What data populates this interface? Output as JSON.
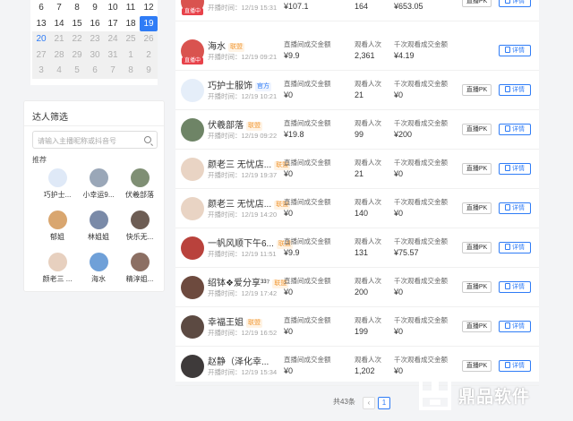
{
  "calendar": {
    "rows": [
      [
        {
          "d": "6",
          "s": ""
        },
        {
          "d": "7",
          "s": ""
        },
        {
          "d": "8",
          "s": ""
        },
        {
          "d": "9",
          "s": ""
        },
        {
          "d": "10",
          "s": ""
        },
        {
          "d": "11",
          "s": ""
        },
        {
          "d": "12",
          "s": ""
        }
      ],
      [
        {
          "d": "13",
          "s": ""
        },
        {
          "d": "14",
          "s": ""
        },
        {
          "d": "15",
          "s": ""
        },
        {
          "d": "16",
          "s": ""
        },
        {
          "d": "17",
          "s": ""
        },
        {
          "d": "18",
          "s": ""
        },
        {
          "d": "19",
          "s": "sel"
        }
      ],
      [
        {
          "d": "20",
          "s": "blue bg"
        },
        {
          "d": "21",
          "s": "gray"
        },
        {
          "d": "22",
          "s": "gray"
        },
        {
          "d": "23",
          "s": "gray"
        },
        {
          "d": "24",
          "s": "gray"
        },
        {
          "d": "25",
          "s": "gray"
        },
        {
          "d": "26",
          "s": "gray"
        }
      ],
      [
        {
          "d": "27",
          "s": "gray"
        },
        {
          "d": "28",
          "s": "gray"
        },
        {
          "d": "29",
          "s": "gray"
        },
        {
          "d": "30",
          "s": "gray"
        },
        {
          "d": "31",
          "s": "gray"
        },
        {
          "d": "1",
          "s": "gray"
        },
        {
          "d": "2",
          "s": "gray"
        }
      ],
      [
        {
          "d": "3",
          "s": "gray"
        },
        {
          "d": "4",
          "s": "gray"
        },
        {
          "d": "5",
          "s": "gray"
        },
        {
          "d": "6",
          "s": "gray"
        },
        {
          "d": "7",
          "s": "gray"
        },
        {
          "d": "8",
          "s": "gray"
        },
        {
          "d": "9",
          "s": "gray"
        }
      ]
    ]
  },
  "filter": {
    "title": "达人筛选",
    "search_placeholder": "请输入主播昵称或抖音号",
    "recommend_label": "推荐",
    "recommended": [
      {
        "name": "巧护士...",
        "color": "#dfe9f7"
      },
      {
        "name": "小幸运9...",
        "color": "#9aa7b8"
      },
      {
        "name": "伏羲部落",
        "color": "#7f8f74"
      },
      {
        "name": "郁姐",
        "color": "#d9a66f"
      },
      {
        "name": "林姐姐",
        "color": "#7a8aa8"
      },
      {
        "name": "快乐无...",
        "color": "#6d5d54"
      },
      {
        "name": "颜老三 ...",
        "color": "#e7d0bf"
      },
      {
        "name": "海水",
        "color": "#6fa0d8"
      },
      {
        "name": "精淳姐...",
        "color": "#8c6f63"
      }
    ]
  },
  "list": {
    "labels": {
      "gmv": "直播间成交金额",
      "viewers": "观看人次",
      "per_thousand": "千次观看成交金额",
      "pk_btn": "直播PK",
      "detail_btn": "详情",
      "live_badge": "直播中"
    },
    "rows": [
      {
        "name": "",
        "tag": "",
        "time": "开播时间：12/19 15:31",
        "gmv": "¥107.1",
        "viewers": "164",
        "ptv": "¥653.05",
        "pk": true,
        "color": "#d9534f"
      },
      {
        "name": "海水",
        "tag": "联盟",
        "tag_type": "alliance",
        "time": "开播时间：12/19 09:21",
        "gmv": "¥9.9",
        "viewers": "2,361",
        "ptv": "¥4.19",
        "pk": false,
        "color": "#d9534f"
      },
      {
        "name": "巧护士服饰",
        "tag": "官方",
        "tag_type": "official",
        "time": "开播时间：12/19 10:21",
        "gmv": "¥0",
        "viewers": "21",
        "ptv": "¥0",
        "pk": true,
        "color": "#e5eef9"
      },
      {
        "name": "伏羲部落",
        "tag": "联盟",
        "tag_type": "alliance",
        "time": "开播时间：12/19 09:22",
        "gmv": "¥19.8",
        "viewers": "99",
        "ptv": "¥200",
        "pk": true,
        "color": "#6e8466"
      },
      {
        "name": "颜老三 无忧店...",
        "tag": "联盟",
        "tag_type": "alliance",
        "time": "开播时间：12/19 19:37",
        "gmv": "¥0",
        "viewers": "21",
        "ptv": "¥0",
        "pk": true,
        "color": "#e9d4c4"
      },
      {
        "name": "颜老三 无忧店...",
        "tag": "联盟",
        "tag_type": "alliance",
        "time": "开播时间：12/19 14:20",
        "gmv": "¥0",
        "viewers": "140",
        "ptv": "¥0",
        "pk": true,
        "color": "#e9d4c4"
      },
      {
        "name": "一帆风顺下午6...",
        "tag": "联盟",
        "tag_type": "alliance",
        "time": "开播时间：12/19 11:51",
        "gmv": "¥9.9",
        "viewers": "131",
        "ptv": "¥75.57",
        "pk": true,
        "color": "#b9423c"
      },
      {
        "name": "绍钵❖爱分享³³⁷",
        "tag": "联盟",
        "tag_type": "alliance",
        "time": "开播时间：12/19 17:42",
        "gmv": "¥0",
        "viewers": "200",
        "ptv": "¥0",
        "pk": true,
        "color": "#6d4a3e"
      },
      {
        "name": "幸福王姐",
        "tag": "联盟",
        "tag_type": "alliance",
        "time": "开播时间：12/19 16:52",
        "gmv": "¥0",
        "viewers": "199",
        "ptv": "¥0",
        "pk": true,
        "color": "#5c4a42"
      },
      {
        "name": "赵静（泽化幸...",
        "tag": "",
        "tag_type": "",
        "time": "开播时间：12/19 15:34",
        "gmv": "¥0",
        "viewers": "1,202",
        "ptv": "¥0",
        "pk": true,
        "color": "#3e3a3a"
      }
    ]
  },
  "pagination": {
    "total": "共43条",
    "current": "1",
    "prev": "‹"
  },
  "watermark": {
    "text": "鼎品软件"
  }
}
